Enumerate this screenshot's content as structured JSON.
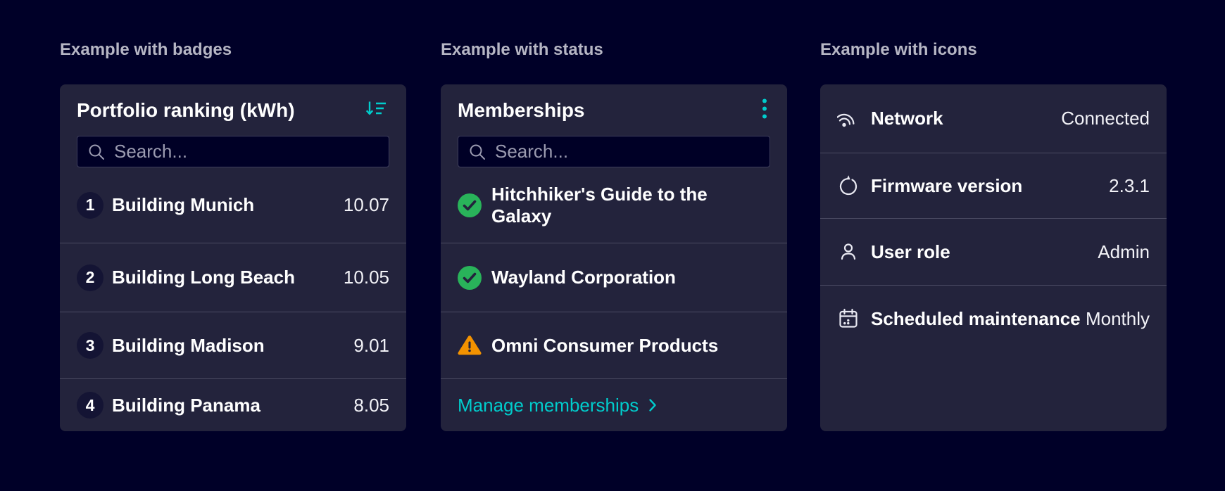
{
  "colors": {
    "page_bg": "#000028",
    "card_bg": "#23233c",
    "accent": "#00cccc",
    "success": "#29b35a",
    "warning": "#f39200"
  },
  "badges_example": {
    "section_title": "Example with badges",
    "card_title": "Portfolio ranking (kWh)",
    "header_icon": "sort-descending-icon",
    "search_placeholder": "Search...",
    "items": [
      {
        "rank": "1",
        "label": "Building Munich",
        "value": "10.07"
      },
      {
        "rank": "2",
        "label": "Building Long Beach",
        "value": "10.05"
      },
      {
        "rank": "3",
        "label": "Building Madison",
        "value": "9.01"
      },
      {
        "rank": "4",
        "label": "Building Panama",
        "value": "8.05"
      }
    ]
  },
  "status_example": {
    "section_title": "Example with status",
    "card_title": "Memberships",
    "header_icon": "kebab-menu-icon",
    "search_placeholder": "Search...",
    "items": [
      {
        "label": "Hitchhiker's Guide to the Galaxy",
        "status": "success",
        "status_icon": "success-check-icon"
      },
      {
        "label": "Wayland Corporation",
        "status": "success",
        "status_icon": "success-check-icon"
      },
      {
        "label": "Omni Consumer Products",
        "status": "warning",
        "status_icon": "warning-triangle-icon"
      }
    ],
    "footer": {
      "link_label": "Manage memberships",
      "chevron_icon": "chevron-right-icon"
    }
  },
  "icons_example": {
    "section_title": "Example with icons",
    "rows": [
      {
        "icon": "network-signal-icon",
        "label": "Network",
        "value": "Connected"
      },
      {
        "icon": "firmware-reset-icon",
        "label": "Firmware version",
        "value": "2.3.1"
      },
      {
        "icon": "user-role-icon",
        "label": "User role",
        "value": "Admin"
      },
      {
        "icon": "maintenance-calendar-icon",
        "label": "Scheduled maintenance",
        "value": "Monthly"
      }
    ]
  }
}
